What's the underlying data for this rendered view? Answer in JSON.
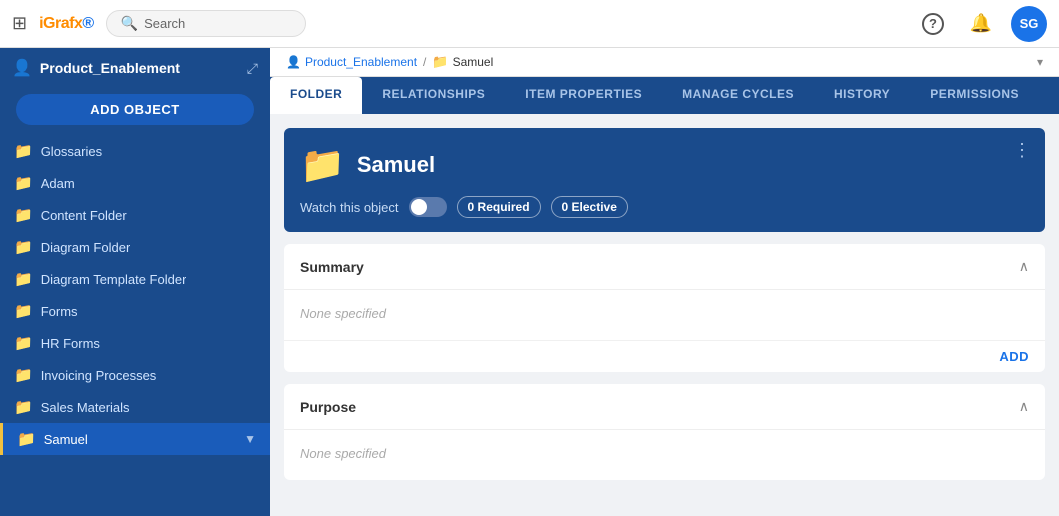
{
  "topNav": {
    "logo": "iGrafx",
    "logoAccent": "i",
    "searchPlaceholder": "Search",
    "helpIcon": "?",
    "bellIcon": "🔔",
    "avatarText": "SG"
  },
  "sidebar": {
    "workspaceIcon": "👤",
    "title": "Product_Enablement",
    "addObjectLabel": "ADD OBJECT",
    "items": [
      {
        "label": "Glossaries",
        "icon": "📁",
        "active": false
      },
      {
        "label": "Adam",
        "icon": "📁",
        "active": false
      },
      {
        "label": "Content Folder",
        "icon": "📁",
        "active": false
      },
      {
        "label": "Diagram Folder",
        "icon": "📁",
        "active": false
      },
      {
        "label": "Diagram Template Folder",
        "icon": "📁",
        "active": false
      },
      {
        "label": "Forms",
        "icon": "📁",
        "active": false
      },
      {
        "label": "HR Forms",
        "icon": "📁",
        "active": false
      },
      {
        "label": "Invoicing Processes",
        "icon": "📁",
        "active": false
      },
      {
        "label": "Sales Materials",
        "icon": "📁",
        "active": false
      },
      {
        "label": "Samuel",
        "icon": "📁",
        "active": true
      }
    ]
  },
  "breadcrumb": {
    "items": [
      {
        "label": "Product_Enablement",
        "icon": "👤"
      },
      {
        "label": "Samuel",
        "icon": "📁"
      }
    ]
  },
  "tabs": [
    {
      "label": "FOLDER",
      "active": true
    },
    {
      "label": "RELATIONSHIPS",
      "active": false
    },
    {
      "label": "ITEM PROPERTIES",
      "active": false
    },
    {
      "label": "MANAGE CYCLES",
      "active": false
    },
    {
      "label": "HISTORY",
      "active": false
    },
    {
      "label": "PERMISSIONS",
      "active": false
    }
  ],
  "objectHeader": {
    "title": "Samuel",
    "watchLabel": "Watch this object",
    "requiredBadge": "0 Required",
    "electiveBadge": "0 Elective",
    "moreIcon": "⋮"
  },
  "sections": [
    {
      "title": "Summary",
      "bodyText": "None specified",
      "hasAddLink": true,
      "addLabel": "ADD"
    },
    {
      "title": "Purpose",
      "bodyText": "None specified",
      "hasAddLink": false,
      "addLabel": ""
    }
  ]
}
